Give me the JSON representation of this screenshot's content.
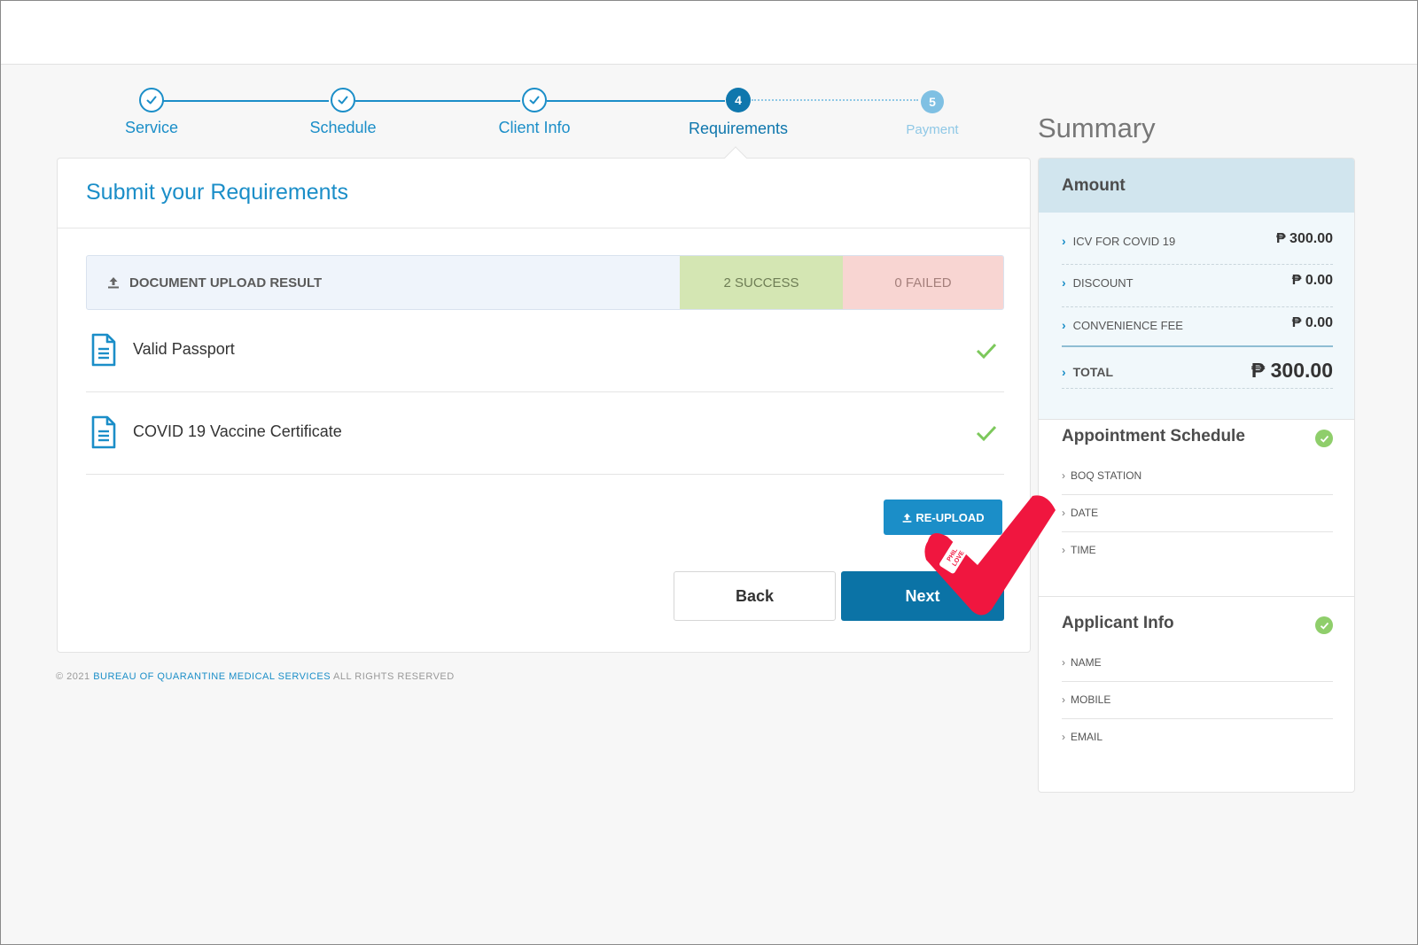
{
  "stepper": {
    "steps": [
      {
        "label": "Service",
        "state": "done"
      },
      {
        "label": "Schedule",
        "state": "done"
      },
      {
        "label": "Client Info",
        "state": "done"
      },
      {
        "label": "Requirements",
        "number": "4",
        "state": "active"
      },
      {
        "label": "Payment",
        "number": "5",
        "state": "todo"
      }
    ]
  },
  "main": {
    "title": "Submit your Requirements",
    "upload_result": {
      "heading": "DOCUMENT UPLOAD RESULT",
      "success": "2 SUCCESS",
      "failed": "0 FAILED"
    },
    "documents": [
      {
        "name": "Valid Passport",
        "status": "uploaded"
      },
      {
        "name": "COVID 19 Vaccine Certificate",
        "status": "uploaded"
      }
    ],
    "reupload_label": "RE-UPLOAD",
    "back_label": "Back",
    "next_label": "Next"
  },
  "footer": {
    "prefix": "© 2021",
    "org": "BUREAU OF QUARANTINE MEDICAL SERVICES",
    "suffix": "ALL RIGHTS RESERVED"
  },
  "summary": {
    "title": "Summary",
    "amount": {
      "heading": "Amount",
      "rows": [
        {
          "label": "ICV FOR COVID 19",
          "value": "₱ 300.00"
        },
        {
          "label": "DISCOUNT",
          "value": "₱ 0.00"
        },
        {
          "label": "CONVENIENCE FEE",
          "value": "₱ 0.00"
        }
      ],
      "total_label": "TOTAL",
      "total_value": "₱ 300.00"
    },
    "appointment": {
      "heading": "Appointment Schedule",
      "items": [
        "BOQ STATION",
        "DATE",
        "TIME"
      ]
    },
    "applicant": {
      "heading": "Applicant Info",
      "items": [
        "NAME",
        "MOBILE",
        "EMAIL"
      ]
    }
  },
  "colors": {
    "primary": "#1b8ec8",
    "next_button": "#0b73a6",
    "success_bg": "#d4e6b3",
    "failed_bg": "#f8d5d2",
    "check_green": "#8fce6b",
    "overlay_red": "#f0163f"
  },
  "icons": {
    "step_done": "check-icon",
    "upload": "upload-icon",
    "document": "document-icon",
    "doc_status": "checkmark-icon",
    "section_status": "check-circle-icon",
    "row_bullet": "chevron-right-icon",
    "overlay": "red-checkmark-icon"
  }
}
